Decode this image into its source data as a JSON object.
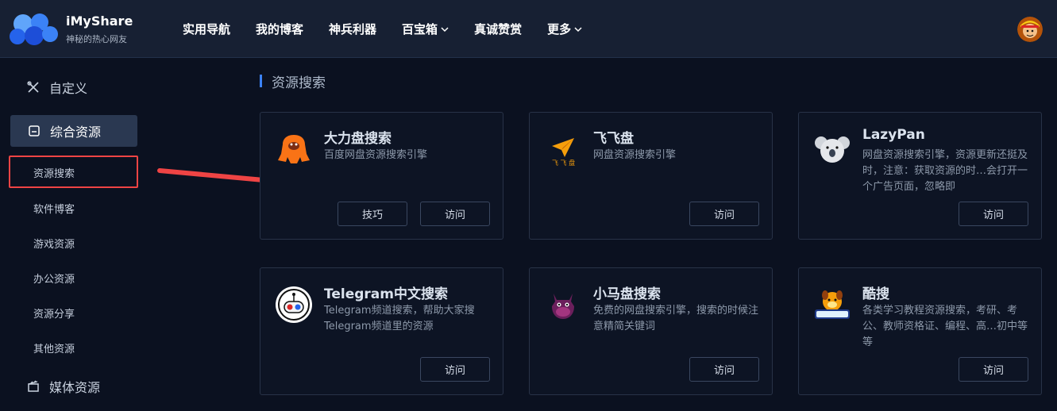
{
  "header": {
    "brand_name": "iMyShare",
    "brand_sub": "神秘的热心网友",
    "nav": [
      {
        "label": "实用导航",
        "dropdown": false
      },
      {
        "label": "我的博客",
        "dropdown": false
      },
      {
        "label": "神兵利器",
        "dropdown": false
      },
      {
        "label": "百宝箱",
        "dropdown": true
      },
      {
        "label": "真诚赞赏",
        "dropdown": false
      },
      {
        "label": "更多",
        "dropdown": true
      }
    ],
    "avatar_icon": "user-avatar-icon"
  },
  "sidebar": {
    "custom_label": "自定义",
    "active_label": "综合资源",
    "sub_items": [
      "资源搜索",
      "软件博客",
      "游戏资源",
      "办公资源",
      "资源分享",
      "其他资源"
    ],
    "media_label": "媒体资源",
    "highlight_color": "#ef4444"
  },
  "main": {
    "section_title": "资源搜索",
    "accent_color": "#3b82f6",
    "cards": [
      {
        "title": "大力盘搜索",
        "desc": "百度网盘资源搜索引擎",
        "buttons": [
          "技巧",
          "访问"
        ],
        "icon": "gorilla-icon"
      },
      {
        "title": "飞飞盘",
        "desc": "网盘资源搜索引擎",
        "buttons": [
          "访问"
        ],
        "icon": "paper-plane-icon"
      },
      {
        "title": "LazyPan",
        "desc": "网盘资源搜索引擎，资源更新还挺及时，注意：获取资源的时…会打开一个广告页面，忽略即",
        "buttons": [
          "访问"
        ],
        "icon": "koala-icon"
      },
      {
        "title": "Telegram中文搜索",
        "desc": "Telegram频道搜索，帮助大家搜Telegram频道里的资源",
        "buttons": [
          "访问"
        ],
        "icon": "telegram-robot-icon"
      },
      {
        "title": "小马盘搜索",
        "desc": "免费的网盘搜索引擎，搜索的时候注意精简关键词",
        "buttons": [
          "访问"
        ],
        "icon": "pony-icon"
      },
      {
        "title": "酷搜",
        "desc": "各类学习教程资源搜索，考研、考公、教师资格证、编程、高…初中等等",
        "buttons": [
          "访问"
        ],
        "icon": "kousou-dog-icon"
      }
    ]
  }
}
